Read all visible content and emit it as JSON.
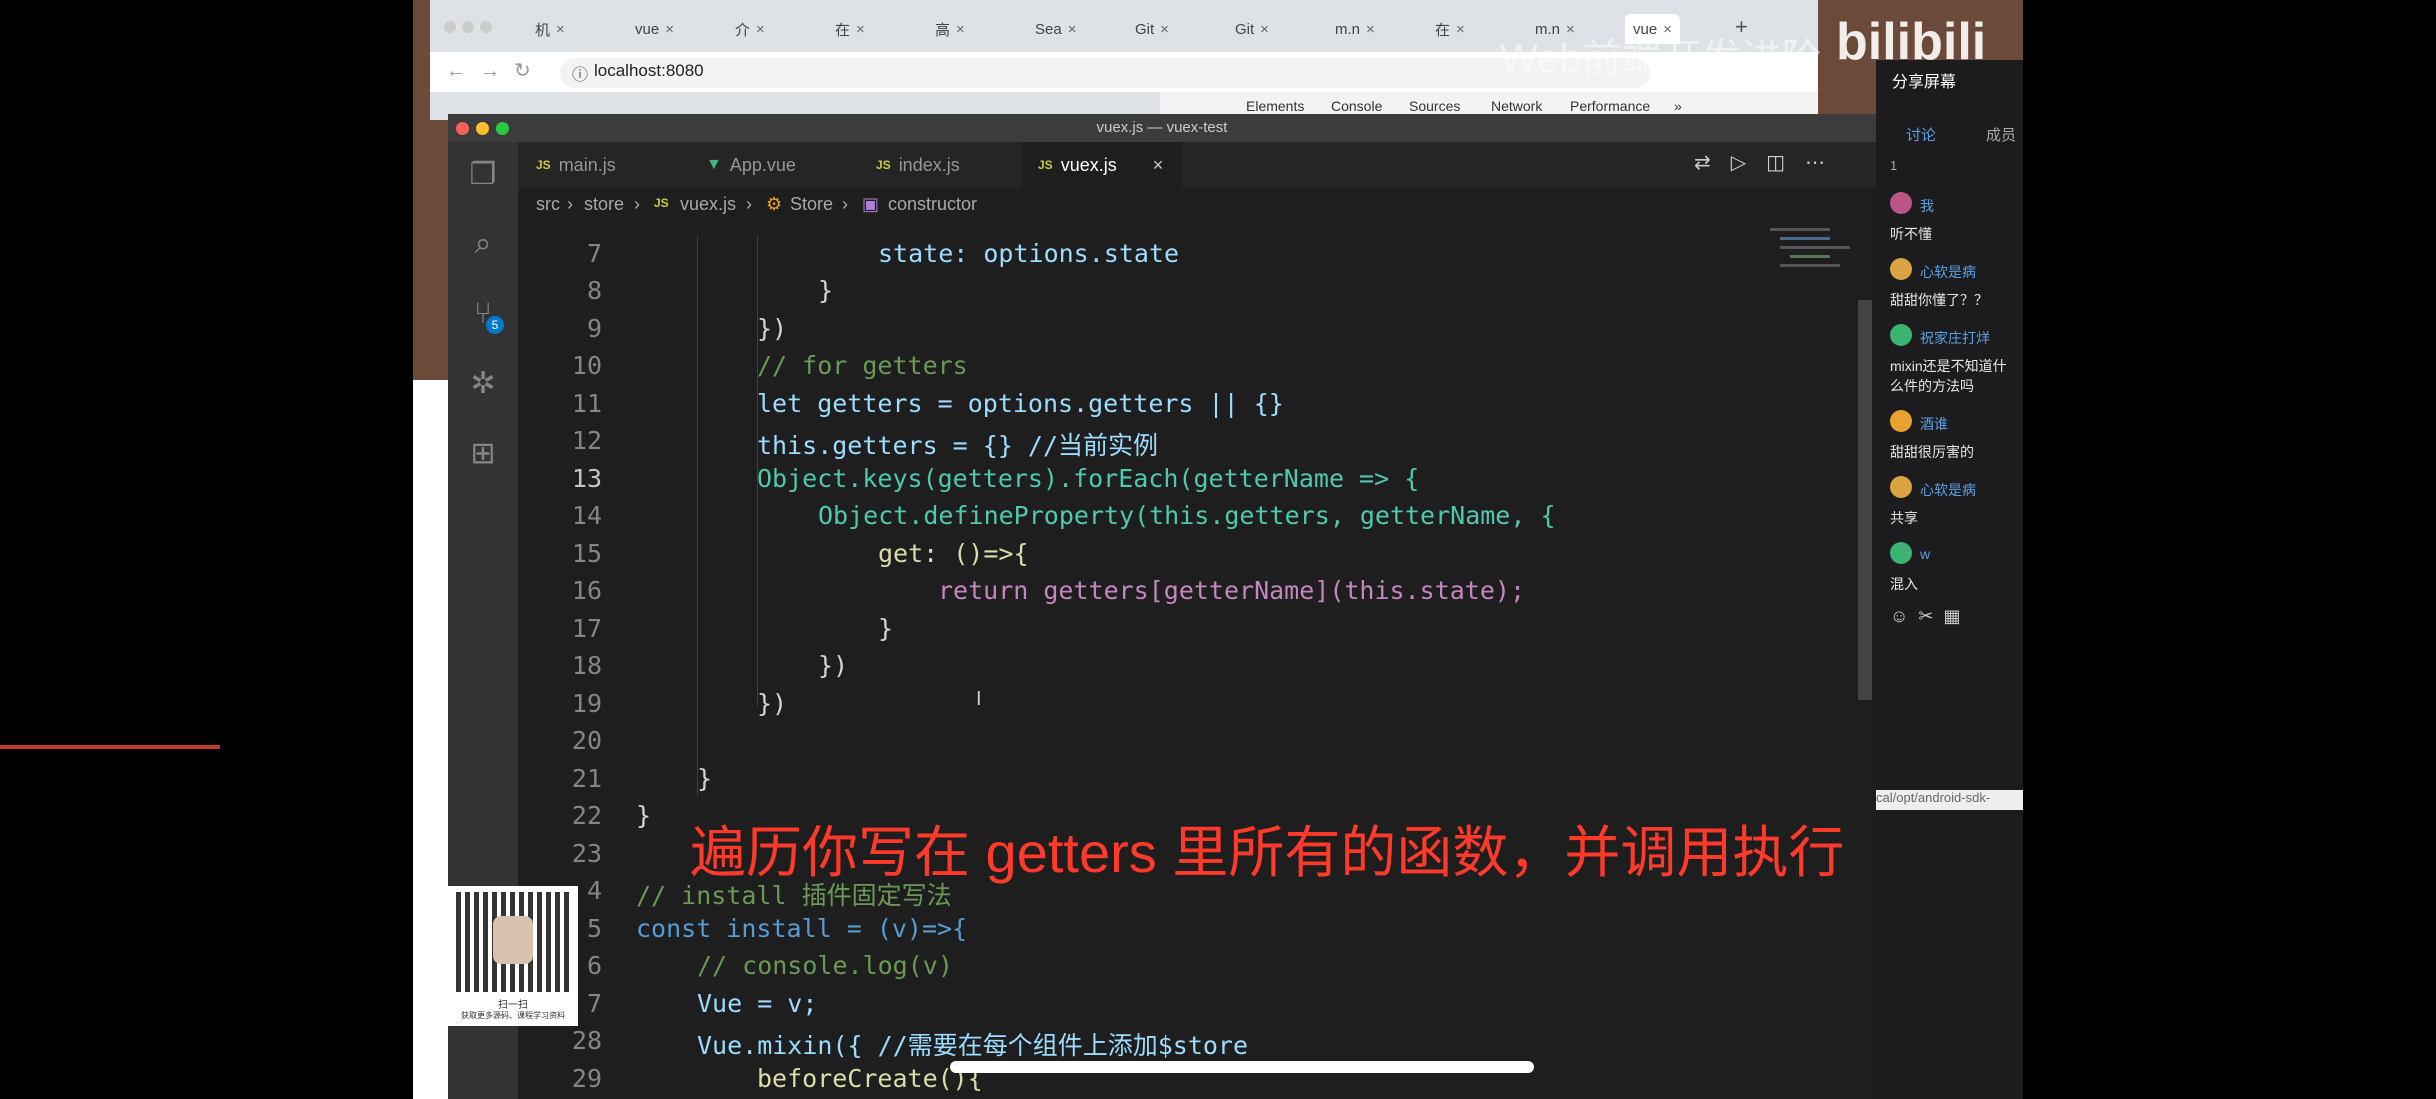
{
  "browser": {
    "tabs": [
      "机",
      "vue",
      "介",
      "在",
      "高",
      "Sea",
      "Git",
      "Git",
      "m.n",
      "在",
      "m.n",
      "vue"
    ],
    "new_tab": "+",
    "url": "localhost:8080",
    "devtools_tabs": [
      "Elements",
      "Console",
      "Sources",
      "Network",
      "Performance",
      "»"
    ]
  },
  "watermark": {
    "text": "Web前端开发进阶",
    "logo": "bilibili",
    "share": "分享屏幕"
  },
  "vscode": {
    "title": "vuex.js — vuex-test",
    "tabs": [
      {
        "label": "main.js",
        "icon": "JS"
      },
      {
        "label": "App.vue",
        "icon": "V"
      },
      {
        "label": "index.js",
        "icon": "JS"
      },
      {
        "label": "vuex.js",
        "icon": "JS",
        "active": true
      }
    ],
    "breadcrumb": [
      "src",
      "store",
      "vuex.js",
      "Store",
      "constructor"
    ],
    "badge": "5",
    "line_numbers": [
      "7",
      "8",
      "9",
      "10",
      "11",
      "12",
      "13",
      "14",
      "15",
      "16",
      "17",
      "18",
      "19",
      "20",
      "21",
      "22",
      "23",
      "4",
      "5",
      "6",
      "7",
      "28",
      "29"
    ],
    "code": [
      "state: options.state",
      "}",
      "})",
      "// for getters",
      "let getters = options.getters || {}",
      "this.getters = {} //当前实例",
      "Object.keys(getters).forEach(getterName => {",
      "Object.defineProperty(this.getters, getterName, {",
      "get: ()=>{",
      "return getters[getterName](this.state);",
      "}",
      "})",
      "})",
      "",
      "}",
      "}",
      "",
      "// install 插件固定写法",
      "const install = (v)=>{",
      "// console.log(v)",
      "Vue = v;",
      "Vue.mixin({ //需要在每个组件上添加$store",
      "beforeCreate(){"
    ]
  },
  "subtitle": "遍历你写在 getters 里所有的函数，并调用执行",
  "qr": {
    "caption": "扫一扫",
    "sub": "获取更多源码、课程学习资料"
  },
  "chat": {
    "tabs": [
      "讨论",
      "成员"
    ],
    "count": "1",
    "messages": [
      {
        "user": "我",
        "text": "听不懂"
      },
      {
        "user": "心软是病",
        "text": "甜甜你懂了？？"
      },
      {
        "user": "祝家庄打烊",
        "text": "mixin还是不知道什么件的方法吗"
      },
      {
        "user": "酒谁",
        "text": "甜甜很厉害的"
      },
      {
        "user": "心软是病",
        "text": "共享"
      },
      {
        "user": "w",
        "text": "混入"
      }
    ],
    "path_text": "cal/opt/android-sdk-"
  }
}
